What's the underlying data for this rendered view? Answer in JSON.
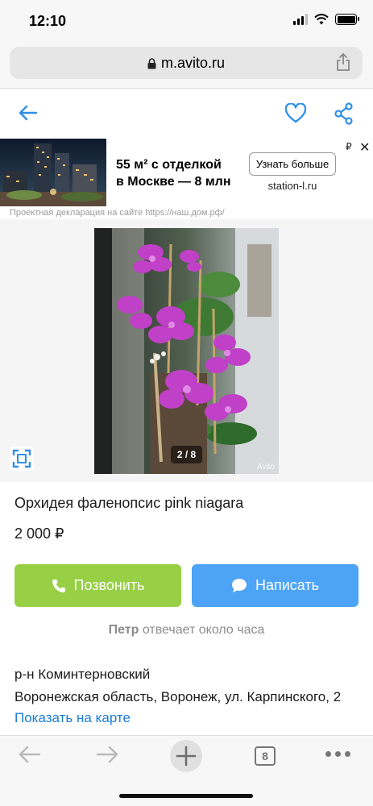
{
  "status_bar": {
    "time": "12:10"
  },
  "browser": {
    "url": "m.avito.ru",
    "open_tabs_count": "8"
  },
  "ad": {
    "headline_line1": "55 м² с отделкой",
    "headline_line2": "в Москве — 8 млн",
    "cta_label": "Узнать больше",
    "domain": "station-l.ru",
    "currency_mark": "₽",
    "close_symbol": "✕",
    "disclaimer": "Проектная декларация на сайте https://наш.дом.рф/"
  },
  "gallery": {
    "counter": "2 / 8",
    "watermark": "Avito"
  },
  "listing": {
    "title": "Орхидея фаленопсис pink niagara",
    "price": "2 000 ₽",
    "call_label": "Позвонить",
    "message_label": "Написать",
    "seller_name": "Петр",
    "seller_response": "отвечает около часа",
    "district": "р-н Коминтерновский",
    "address": "Воронежская область, Воронеж, ул. Карпинского, 2",
    "map_link": "Показать на карте"
  },
  "colors": {
    "call_button": "#97cf45",
    "message_button": "#4da3f5",
    "link": "#1a7cd6",
    "accent_icon": "#2f8fe8"
  }
}
